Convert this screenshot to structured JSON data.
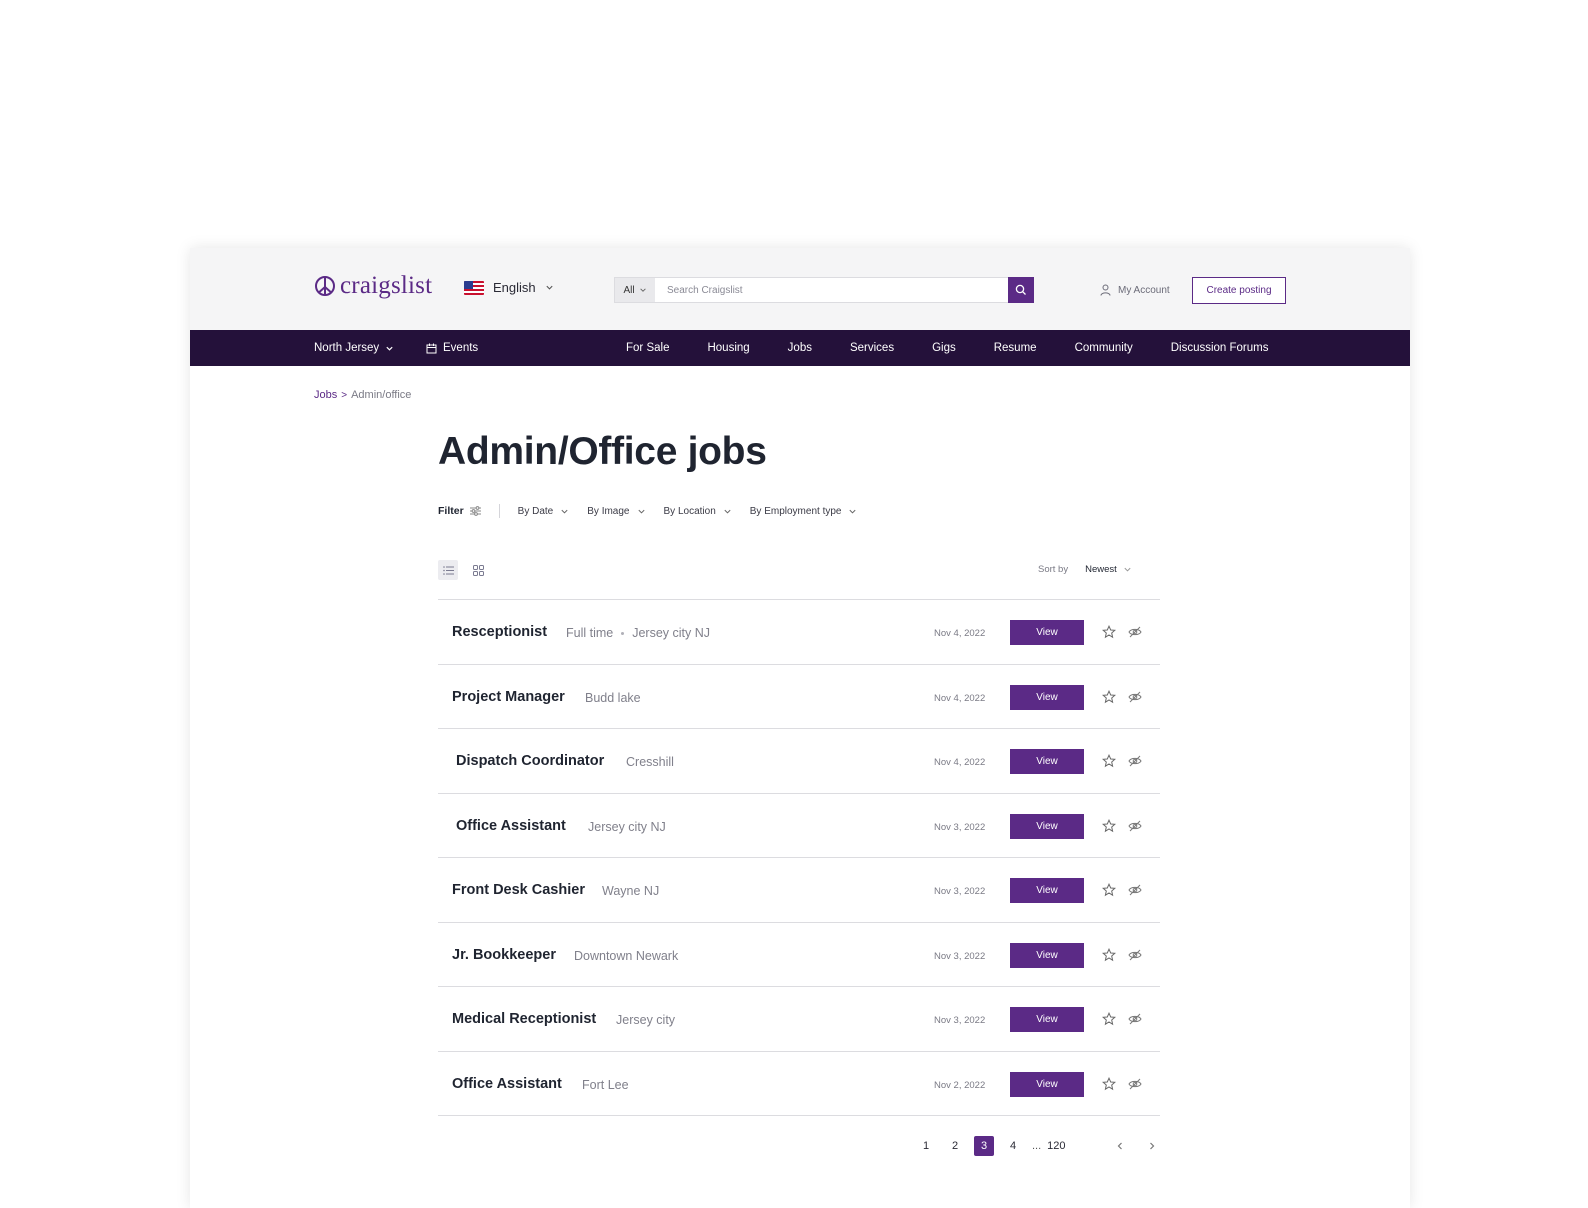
{
  "header": {
    "logo_text": "craigslist",
    "language": "English",
    "search": {
      "category": "All",
      "placeholder": "Search Craigslist"
    },
    "account_label": "My Account",
    "create_posting_label": "Create posting"
  },
  "nav": {
    "region": "North Jersey",
    "events": "Events",
    "categories": [
      "For Sale",
      "Housing",
      "Jobs",
      "Services",
      "Gigs",
      "Resume",
      "Community",
      "Discussion Forums"
    ]
  },
  "breadcrumb": {
    "parent": "Jobs",
    "separator": ">",
    "current": "Admin/office"
  },
  "page_title": "Admin/Office jobs",
  "filters": {
    "label": "Filter",
    "items": [
      "By Date",
      "By Image",
      "By Location",
      "By Employment type"
    ]
  },
  "sort": {
    "label": "Sort by",
    "value": "Newest"
  },
  "listings": [
    {
      "title": "Resceptionist",
      "type": "Full time",
      "location": "Jersey city NJ",
      "date": "Nov 4, 2022",
      "button": "View"
    },
    {
      "title": "Project Manager",
      "location": "Budd lake",
      "date": "Nov 4, 2022",
      "button": "View"
    },
    {
      "title": "Dispatch Coordinator",
      "location": "Cresshill",
      "date": "Nov 4, 2022",
      "button": "View"
    },
    {
      "title": "Office Assistant",
      "location": "Jersey city NJ",
      "date": "Nov 3, 2022",
      "button": "View"
    },
    {
      "title": "Front Desk Cashier",
      "location": "Wayne NJ",
      "date": "Nov 3, 2022",
      "button": "View"
    },
    {
      "title": "Jr. Bookkeeper",
      "location": "Downtown Newark",
      "date": "Nov 3, 2022",
      "button": "View"
    },
    {
      "title": "Medical Receptionist",
      "location": "Jersey city",
      "date": "Nov 3, 2022",
      "button": "View"
    },
    {
      "title": "Office Assistant",
      "location": "Fort Lee",
      "date": "Nov 2, 2022",
      "button": "View"
    }
  ],
  "pagination": {
    "pages": [
      "1",
      "2",
      "3",
      "4"
    ],
    "current": "3",
    "ellipsis": "...",
    "last": "120"
  },
  "colors": {
    "brand": "#5b2a86",
    "navbar": "#24113a",
    "topbar": "#f5f5f6"
  },
  "icons": {
    "logo": "peace-icon",
    "search": "search-icon",
    "account": "user-icon",
    "events": "calendar-icon",
    "filter": "sliders-icon",
    "list_view": "list-icon",
    "grid_view": "grid-icon",
    "favorite": "star-icon",
    "hide": "eye-off-icon"
  }
}
